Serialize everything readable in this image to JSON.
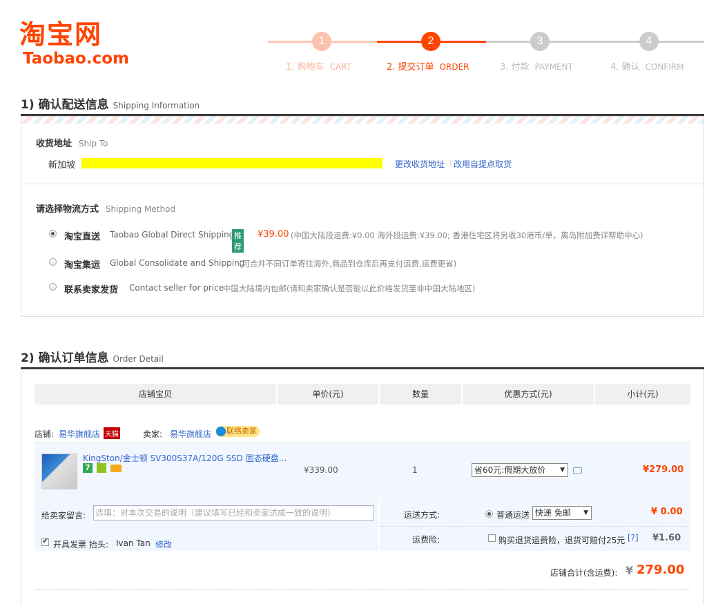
{
  "logo": {
    "cn": "淘宝网",
    "en": "Taobao.com"
  },
  "steps": [
    {
      "num": "1",
      "cn": "1. 购物车",
      "en": "CART"
    },
    {
      "num": "2",
      "cn": "2. 提交订单",
      "en": "ORDER"
    },
    {
      "num": "3",
      "cn": "3. 付款",
      "en": "PAYMENT"
    },
    {
      "num": "4",
      "cn": "4. 确认",
      "en": "CONFIRM"
    }
  ],
  "shipping_section": {
    "title": "1) 确认配送信息",
    "subtitle": "Shipping Information"
  },
  "ship_to": {
    "label": "收货地址",
    "label_en": "Ship To",
    "country": "新加坡",
    "change_address": "更改收货地址",
    "self_pickup": "改用自提点取货"
  },
  "shipping_method": {
    "label": "请选择物流方式",
    "label_en": "Shipping Method",
    "options": [
      {
        "name": "淘宝直送",
        "en": "Taobao Global Direct Shipping",
        "badge": "推荐",
        "price": "¥39.00",
        "note": "(中国大陆段运费:¥0.00 海外段运费:¥39.00; 香港住宅区将另收30港币/单，离岛附加费详帮助中心)",
        "selected": true
      },
      {
        "name": "淘宝集运",
        "en": "Global Consolidate and Shipping",
        "note": "(可合并不同订单寄往海外,商品到仓库后再支付运费,运费更省)",
        "selected": false
      },
      {
        "name": "联系卖家发货",
        "en": "Contact seller for price",
        "note": "中国大陆境内包邮(请和卖家确认是否能以此价格发货至非中国大陆地区)",
        "selected": false
      }
    ]
  },
  "order_section": {
    "title": "2) 确认订单信息",
    "subtitle": "Order Detail"
  },
  "table_headers": {
    "item": "店铺宝贝",
    "unit_price": "单价(元)",
    "qty": "数量",
    "discount": "优惠方式(元)",
    "subtotal": "小计(元)"
  },
  "shop": {
    "label": "店铺:",
    "name": "易华旗舰店",
    "tmall_badge": "天猫",
    "seller_label": "卖家:",
    "seller_name": "易华旗舰店",
    "contact_badge": "联络卖家"
  },
  "product": {
    "title": "KingSton/金士顿 SV300S37A/120G SSD 固态硬盘...",
    "price": "¥339.00",
    "qty": "1",
    "discount": "省60元:假期大放价",
    "subtotal": "¥279.00"
  },
  "message": {
    "label": "给卖家留言:",
    "placeholder": "选填：对本次交易的说明（建议填写已经和卖家达成一致的说明）"
  },
  "delivery": {
    "label": "运送方式:",
    "option": "普通运送",
    "select": "快递 免邮",
    "fee": "¥ 0.00"
  },
  "insurance": {
    "label": "运费险:",
    "text": "购买退货运费险，退货可赔付25元",
    "help": "[?]",
    "fee": "¥1.60"
  },
  "invoice": {
    "label": "开具发票",
    "title_label": "抬头:",
    "name": "Ivan Tan",
    "edit": "修改"
  },
  "shop_total": {
    "label": "店铺合计(含运费):",
    "currency": "¥",
    "amount": "279.00"
  },
  "colors": {
    "accent": "#ff4400",
    "link": "#3366cc",
    "inactive_step": "#cccccc",
    "badge_green": "#2a9b78"
  }
}
